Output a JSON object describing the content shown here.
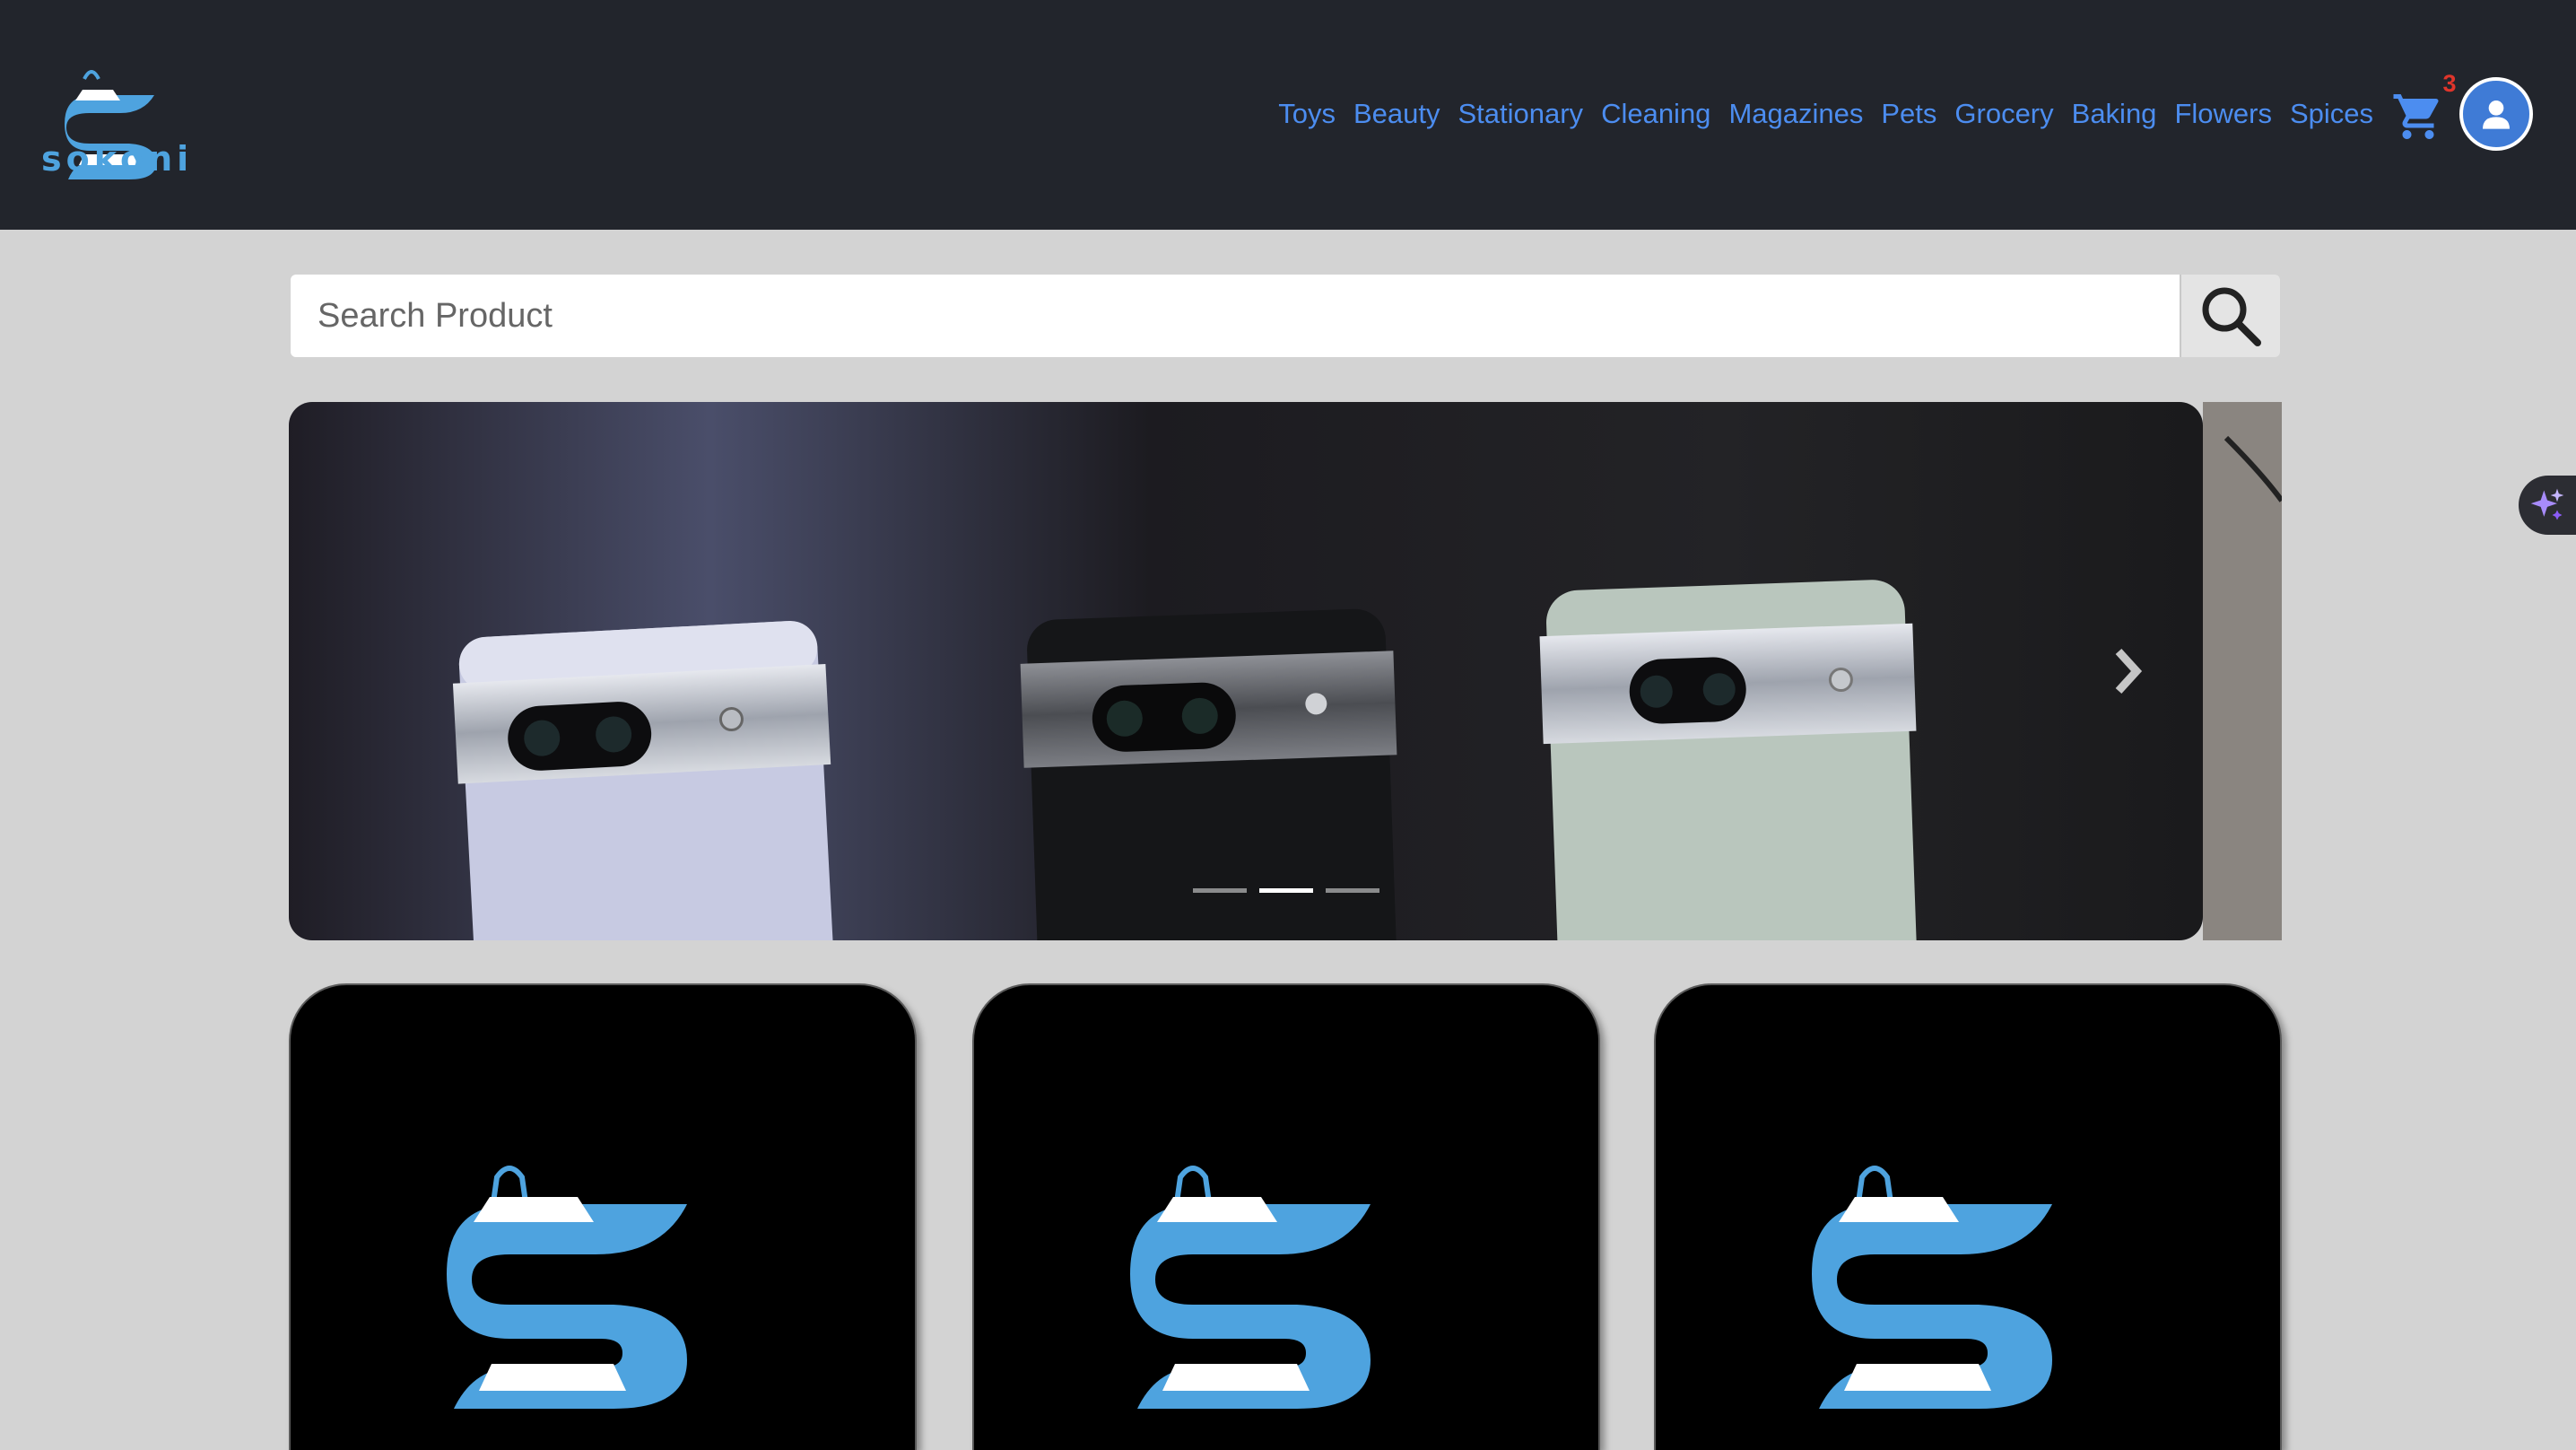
{
  "brand": {
    "name": "sokoni",
    "color": "#4ea3df",
    "icon": "shopping-bag-s-logo"
  },
  "nav": {
    "links": [
      "Toys",
      "Beauty",
      "Stationary",
      "Cleaning",
      "Magazines",
      "Pets",
      "Grocery",
      "Baking",
      "Flowers",
      "Spices"
    ],
    "link_color": "#4c8df0",
    "background": "#22252c"
  },
  "cart": {
    "icon": "shopping-cart-icon",
    "count": "3"
  },
  "user": {
    "icon": "user-avatar-icon"
  },
  "search": {
    "placeholder": "Search Product",
    "icon": "search-icon"
  },
  "carousel": {
    "slide": "three-pixel-phones-photo",
    "slide_count": 3,
    "active_index": 1,
    "prev_icon": "chevron-left-icon",
    "next_icon": "chevron-right-icon"
  },
  "products": {
    "count": 3,
    "card_image": "sokoni-logo"
  },
  "ai_tab": {
    "icon": "sparkles-icon"
  }
}
